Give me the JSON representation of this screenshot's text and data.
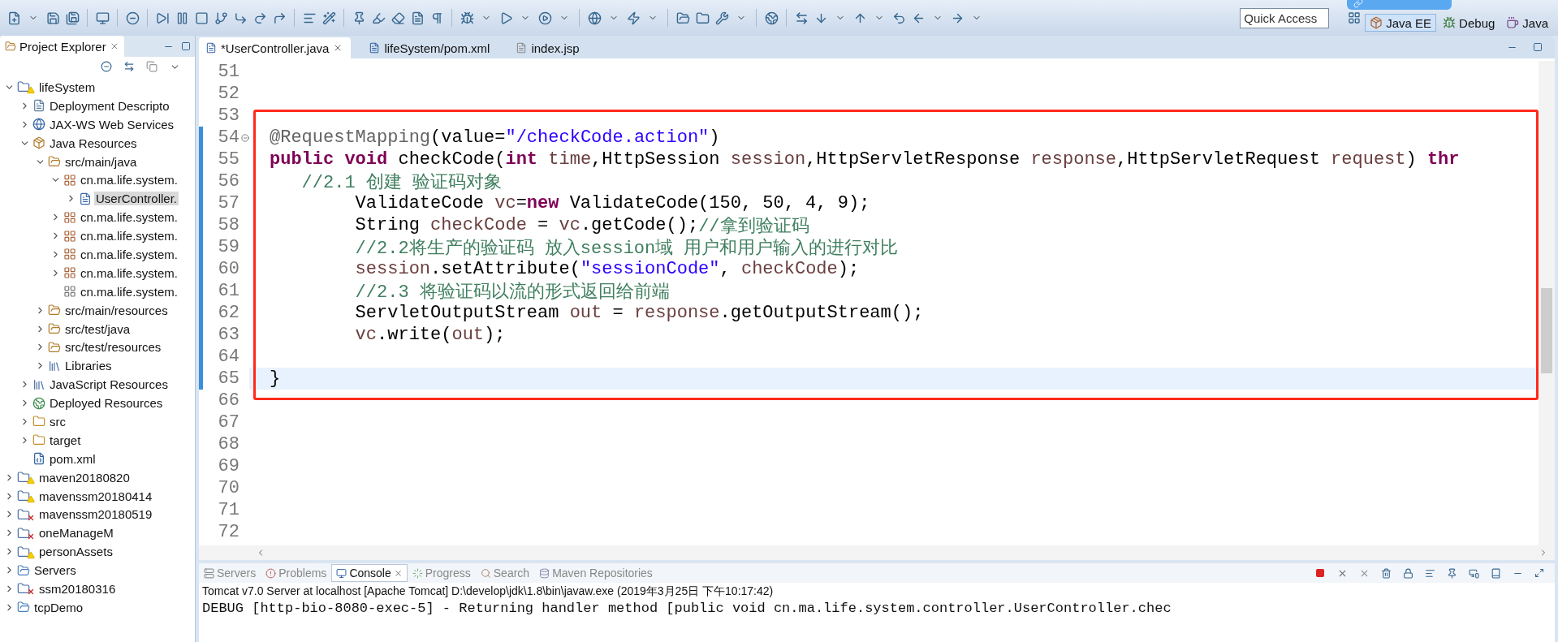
{
  "toolbar": {
    "quick_access": {
      "placeholder": "Quick Access"
    },
    "perspectives": [
      {
        "label": "Java EE",
        "kind": "javaee",
        "selected": true
      },
      {
        "label": "Debug",
        "kind": "debug",
        "selected": false
      },
      {
        "label": "Java",
        "kind": "java",
        "selected": false
      }
    ]
  },
  "explorer": {
    "title": "Project Explorer",
    "tree": [
      {
        "label": "lifeSystem",
        "kind": "project",
        "error": false,
        "expanded": true,
        "children": [
          {
            "label": "Deployment Descripto",
            "kind": "descriptor",
            "expanded": false
          },
          {
            "label": "JAX-WS Web Services",
            "kind": "webservice",
            "expanded": false
          },
          {
            "label": "Java Resources",
            "kind": "javares",
            "expanded": true,
            "children": [
              {
                "label": "src/main/java",
                "kind": "srcfolder",
                "expanded": true,
                "children": [
                  {
                    "label": "cn.ma.life.system.",
                    "kind": "package",
                    "expanded": true,
                    "children": [
                      {
                        "label": "UserController.",
                        "kind": "javafile",
                        "expanded": false,
                        "selected": true
                      }
                    ]
                  },
                  {
                    "label": "cn.ma.life.system.",
                    "kind": "package",
                    "expanded": false
                  },
                  {
                    "label": "cn.ma.life.system.",
                    "kind": "package",
                    "expanded": false
                  },
                  {
                    "label": "cn.ma.life.system.",
                    "kind": "package",
                    "expanded": false
                  },
                  {
                    "label": "cn.ma.life.system.",
                    "kind": "package",
                    "expanded": false
                  },
                  {
                    "label": "cn.ma.life.system.",
                    "kind": "emptypackage"
                  }
                ]
              },
              {
                "label": "src/main/resources",
                "kind": "srcfolder",
                "expanded": false
              },
              {
                "label": "src/test/java",
                "kind": "srcfolder",
                "expanded": false
              },
              {
                "label": "src/test/resources",
                "kind": "srcfolder",
                "expanded": false
              },
              {
                "label": "Libraries",
                "kind": "library",
                "expanded": false
              }
            ]
          },
          {
            "label": "JavaScript Resources",
            "kind": "library",
            "expanded": false
          },
          {
            "label": "Deployed Resources",
            "kind": "deployed",
            "expanded": false
          },
          {
            "label": "src",
            "kind": "folder",
            "expanded": false
          },
          {
            "label": "target",
            "kind": "folder",
            "expanded": false
          },
          {
            "label": "pom.xml",
            "kind": "xmlfile"
          }
        ]
      },
      {
        "label": "maven20180820",
        "kind": "project",
        "error": false,
        "expanded": false
      },
      {
        "label": "mavenssm20180414",
        "kind": "project",
        "error": false,
        "expanded": false
      },
      {
        "label": "mavenssm20180519",
        "kind": "project",
        "error": true,
        "expanded": false
      },
      {
        "label": "oneManageM",
        "kind": "project",
        "error": true,
        "expanded": false
      },
      {
        "label": "personAssets",
        "kind": "project",
        "error": false,
        "expanded": false
      },
      {
        "label": "Servers",
        "kind": "serverfolder",
        "expanded": false
      },
      {
        "label": "ssm20180316",
        "kind": "project",
        "error": true,
        "expanded": false
      },
      {
        "label": "tcpDemo",
        "kind": "serverfolder",
        "expanded": false
      }
    ]
  },
  "editor": {
    "tabs": [
      {
        "label": "*UserController.java",
        "kind": "java",
        "selected": true
      },
      {
        "label": "lifeSystem/pom.xml",
        "kind": "maven",
        "selected": false
      },
      {
        "label": "index.jsp",
        "kind": "jsp",
        "selected": false
      }
    ],
    "lines": [
      {
        "number": "51",
        "changed": false,
        "current": false,
        "foldable": false
      },
      {
        "number": "52",
        "changed": false,
        "current": false,
        "foldable": false
      },
      {
        "number": "53",
        "changed": false,
        "current": false,
        "foldable": false
      },
      {
        "number": "54",
        "changed": true,
        "current": false,
        "foldable": true,
        "tokens": [
          {
            "kind": "annotation",
            "text": "@RequestMapping"
          },
          {
            "kind": "plain",
            "text": "(value="
          },
          {
            "kind": "string",
            "text": "\"/checkCode.action\""
          },
          {
            "kind": "plain",
            "text": ")"
          }
        ]
      },
      {
        "number": "55",
        "changed": true,
        "current": false,
        "foldable": false,
        "tokens": [
          {
            "kind": "keyword",
            "text": "public void"
          },
          {
            "kind": "plain",
            "text": " checkCode("
          },
          {
            "kind": "keyword",
            "text": "int "
          },
          {
            "kind": "variable",
            "text": "time"
          },
          {
            "kind": "plain",
            "text": ",HttpSession "
          },
          {
            "kind": "variable",
            "text": "session"
          },
          {
            "kind": "plain",
            "text": ",HttpServletResponse "
          },
          {
            "kind": "variable",
            "text": "response"
          },
          {
            "kind": "plain",
            "text": ",HttpServletRequest "
          },
          {
            "kind": "variable",
            "text": "request"
          },
          {
            "kind": "plain",
            "text": ") "
          },
          {
            "kind": "keyword",
            "text": "thr"
          }
        ]
      },
      {
        "number": "56",
        "changed": true,
        "current": false,
        "foldable": false,
        "tokens": [
          {
            "kind": "comment",
            "text": "   //2.1 创建 验证码对象"
          }
        ]
      },
      {
        "number": "57",
        "changed": true,
        "current": false,
        "foldable": false,
        "tokens": [
          {
            "kind": "plain",
            "text": "        ValidateCode "
          },
          {
            "kind": "variable",
            "text": "vc"
          },
          {
            "kind": "plain",
            "text": "="
          },
          {
            "kind": "keyword",
            "text": "new"
          },
          {
            "kind": "plain",
            "text": " ValidateCode(150, 50, 4, 9);"
          }
        ]
      },
      {
        "number": "58",
        "changed": true,
        "current": false,
        "foldable": false,
        "tokens": [
          {
            "kind": "plain",
            "text": "        String "
          },
          {
            "kind": "variable",
            "text": "checkCode"
          },
          {
            "kind": "plain",
            "text": " = "
          },
          {
            "kind": "variable",
            "text": "vc"
          },
          {
            "kind": "plain",
            "text": ".getCode();"
          },
          {
            "kind": "comment",
            "text": "//拿到验证码"
          }
        ]
      },
      {
        "number": "59",
        "changed": true,
        "current": false,
        "foldable": false,
        "tokens": [
          {
            "kind": "comment",
            "text": "        //2.2将生产的验证码 放入session域 用户和用户输入的进行对比"
          }
        ]
      },
      {
        "number": "60",
        "changed": true,
        "current": false,
        "foldable": false,
        "tokens": [
          {
            "kind": "variable",
            "text": "        session"
          },
          {
            "kind": "plain",
            "text": ".setAttribute("
          },
          {
            "kind": "string",
            "text": "\"sessionCode\""
          },
          {
            "kind": "plain",
            "text": ", "
          },
          {
            "kind": "variable",
            "text": "checkCode"
          },
          {
            "kind": "plain",
            "text": ");"
          }
        ]
      },
      {
        "number": "61",
        "changed": true,
        "current": false,
        "foldable": false,
        "tokens": [
          {
            "kind": "comment",
            "text": "        //2.3 将验证码以流的形式返回给前端"
          }
        ]
      },
      {
        "number": "62",
        "changed": true,
        "current": false,
        "foldable": false,
        "tokens": [
          {
            "kind": "plain",
            "text": "        ServletOutputStream "
          },
          {
            "kind": "variable",
            "text": "out"
          },
          {
            "kind": "plain",
            "text": " = "
          },
          {
            "kind": "variable",
            "text": "response"
          },
          {
            "kind": "plain",
            "text": ".getOutputStream();"
          }
        ]
      },
      {
        "number": "63",
        "changed": true,
        "current": false,
        "foldable": false,
        "tokens": [
          {
            "kind": "variable",
            "text": "        vc"
          },
          {
            "kind": "plain",
            "text": ".write("
          },
          {
            "kind": "variable",
            "text": "out"
          },
          {
            "kind": "plain",
            "text": ");"
          }
        ]
      },
      {
        "number": "64",
        "changed": true,
        "current": false,
        "foldable": false
      },
      {
        "number": "65",
        "changed": true,
        "current": true,
        "foldable": false,
        "tokens": [
          {
            "kind": "plain",
            "text": "}"
          }
        ]
      },
      {
        "number": "66",
        "changed": false,
        "current": false,
        "foldable": false
      },
      {
        "number": "67",
        "changed": false,
        "current": false,
        "foldable": false
      },
      {
        "number": "68",
        "changed": false,
        "current": false,
        "foldable": false
      },
      {
        "number": "69",
        "changed": false,
        "current": false,
        "foldable": false
      },
      {
        "number": "70",
        "changed": false,
        "current": false,
        "foldable": false
      },
      {
        "number": "71",
        "changed": false,
        "current": false,
        "foldable": false
      },
      {
        "number": "72",
        "changed": false,
        "current": false,
        "foldable": false
      }
    ]
  },
  "bottom_panel": {
    "tabs": [
      {
        "label": "Servers",
        "kind": "servers",
        "selected": false
      },
      {
        "label": "Problems",
        "kind": "problems",
        "selected": false
      },
      {
        "label": "Console",
        "kind": "console",
        "selected": true
      },
      {
        "label": "Progress",
        "kind": "progress",
        "selected": false
      },
      {
        "label": "Search",
        "kind": "search",
        "selected": false
      },
      {
        "label": "Maven Repositories",
        "kind": "maven",
        "selected": false
      }
    ],
    "console_title": "Tomcat v7.0 Server at localhost [Apache Tomcat] D:\\develop\\jdk\\1.8\\bin\\javaw.exe (2019年3月25日 下午10:17:42)",
    "console_lines": [
      "DEBUG [http-bio-8080-exec-5] - Returning handler method [public void cn.ma.life.system.controller.UserController.chec"
    ]
  }
}
